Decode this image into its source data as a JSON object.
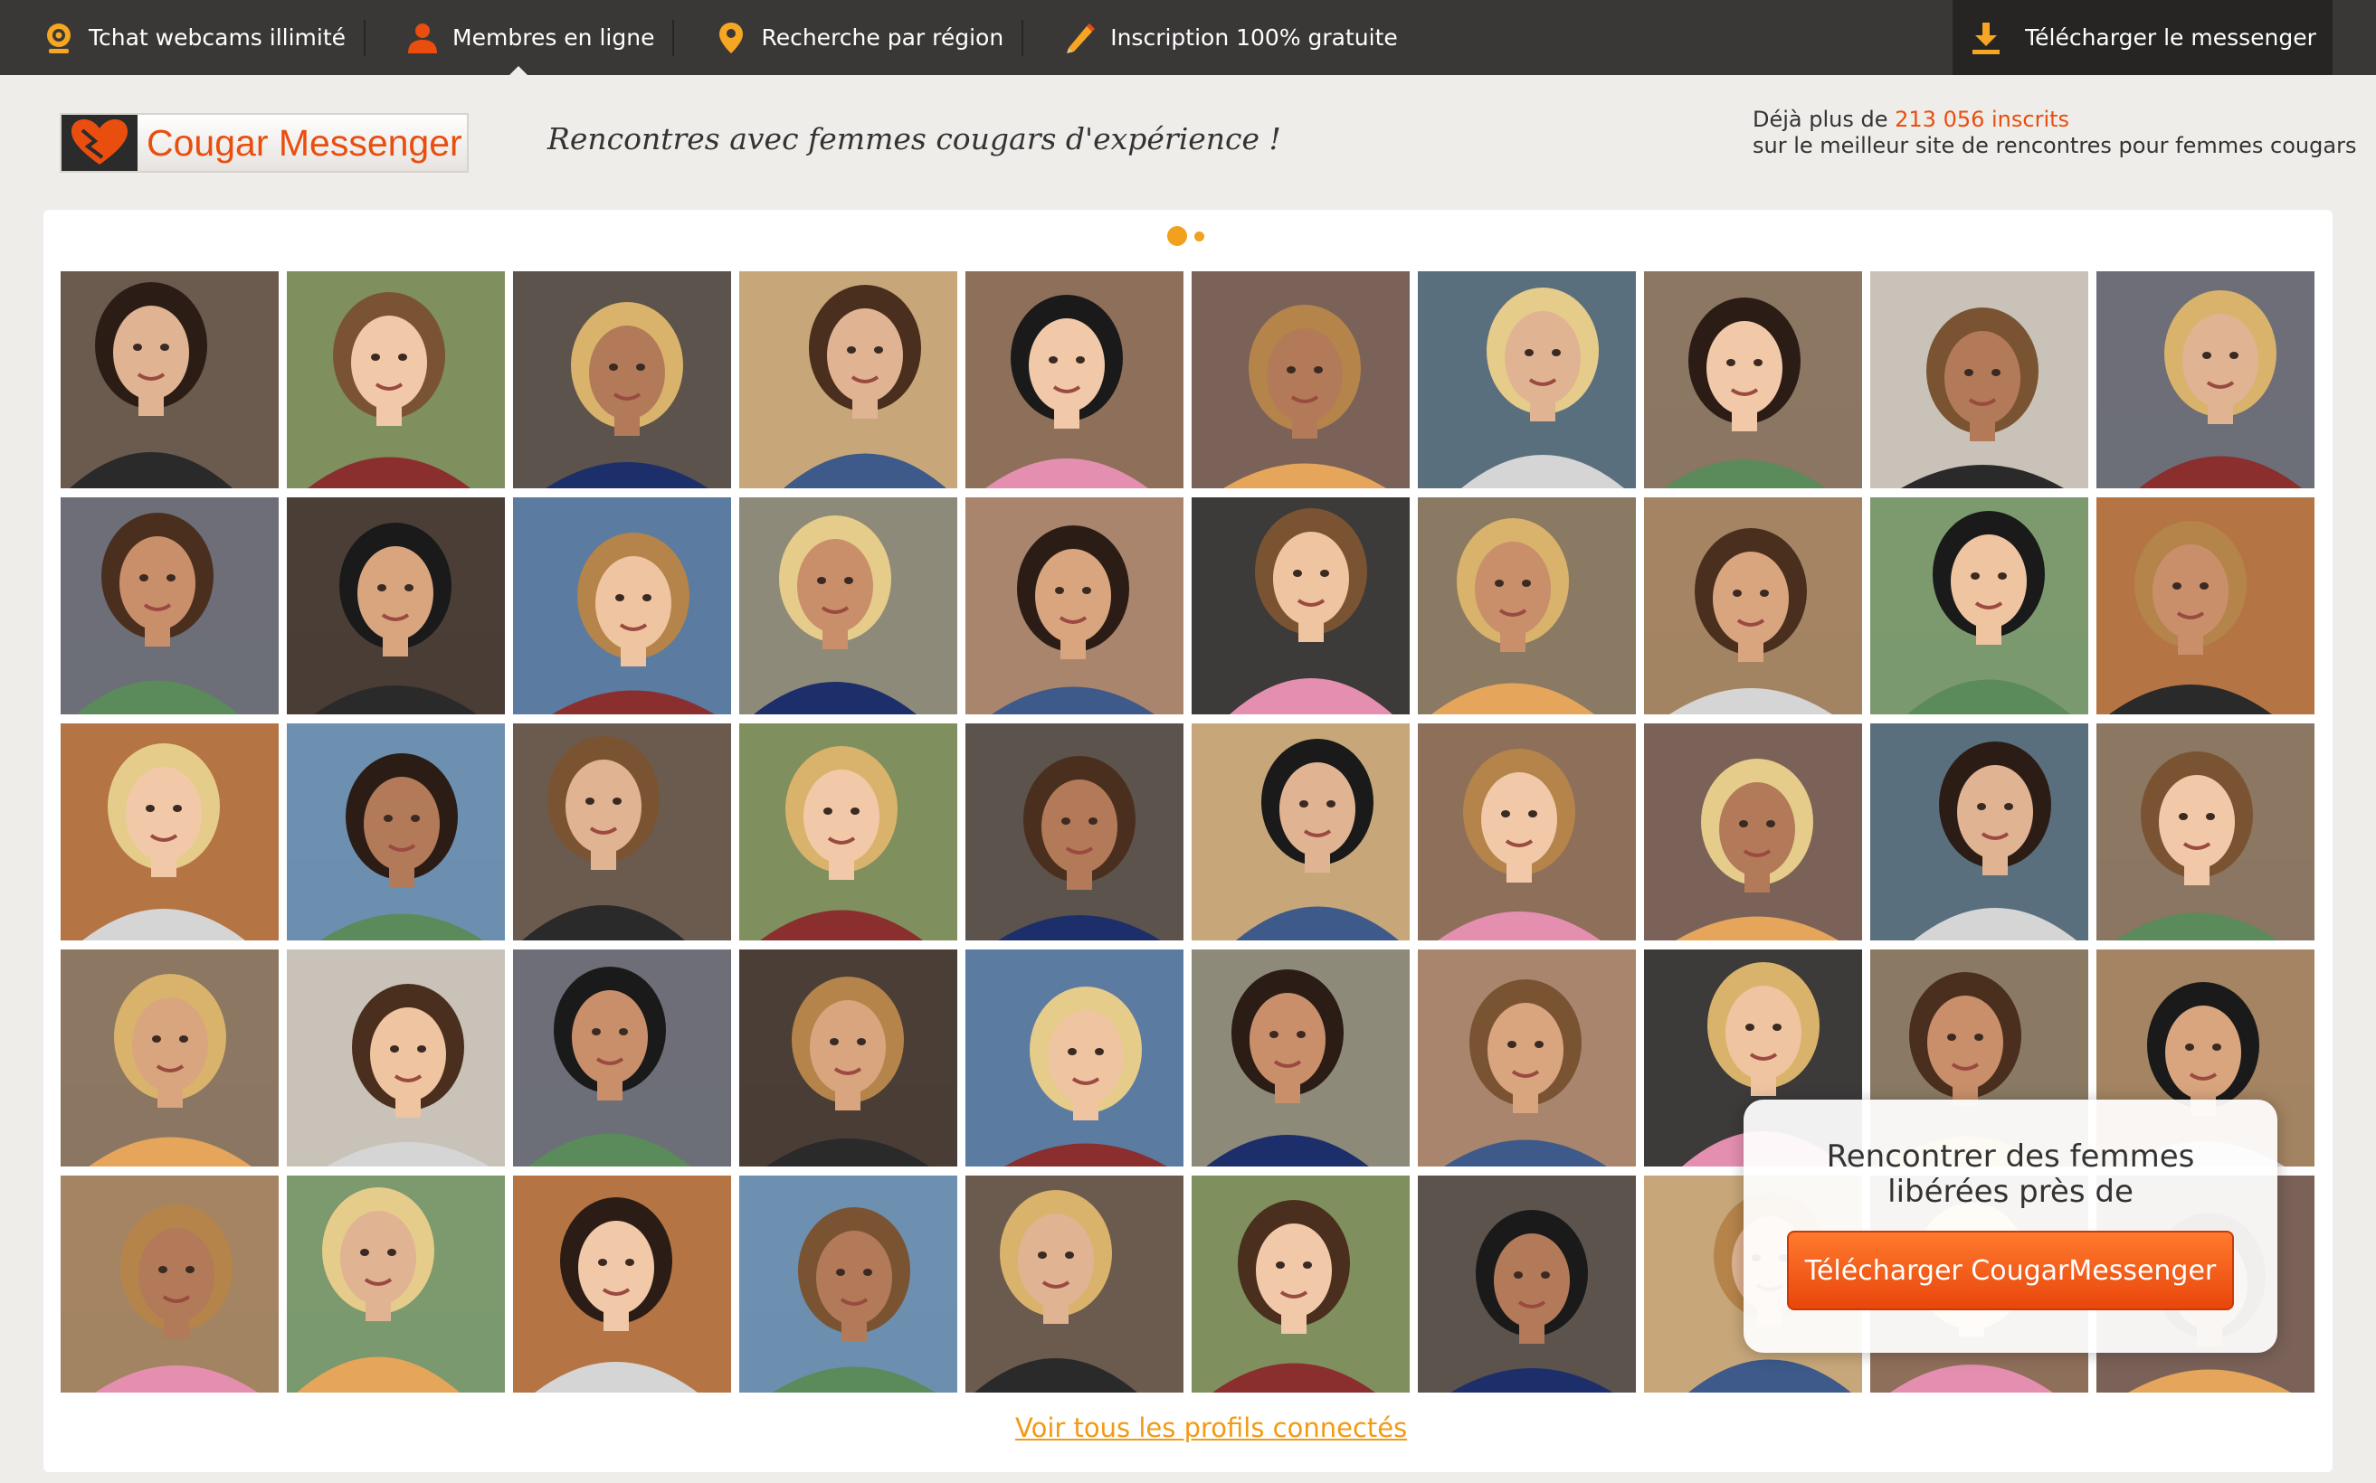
{
  "nav": {
    "items": [
      {
        "label": "Tchat webcams illimité",
        "icon": "webcam-icon",
        "active": false
      },
      {
        "label": "Membres en ligne",
        "icon": "user-icon",
        "active": true
      },
      {
        "label": "Recherche par région",
        "icon": "map-pin-icon",
        "active": false
      },
      {
        "label": "Inscription 100% gratuite",
        "icon": "pencil-icon",
        "active": false
      }
    ],
    "download_label": "Télécharger le messenger",
    "download_icon": "download-icon"
  },
  "header": {
    "logo_text": "Cougar Messenger",
    "tagline": "Rencontres avec femmes cougars d'expérience !",
    "members_prefix": "Déjà plus de ",
    "members_count": "213 056 inscrits",
    "members_suffix": "sur le meilleur site de rencontres pour femmes cougars"
  },
  "gallery": {
    "slides_indicator": {
      "count": 2,
      "active_index": 0
    },
    "rows": 5,
    "columns": 10,
    "see_all_link": "Voir tous les profils connectés"
  },
  "popup": {
    "text": "Rencontrer des femmes libérées près de",
    "button_label": "Télécharger CougarMessenger"
  },
  "colors": {
    "accent_orange": "#e94e0f",
    "link_orange": "#f19b15",
    "topbar": "#3a3837",
    "background": "#efedea"
  }
}
